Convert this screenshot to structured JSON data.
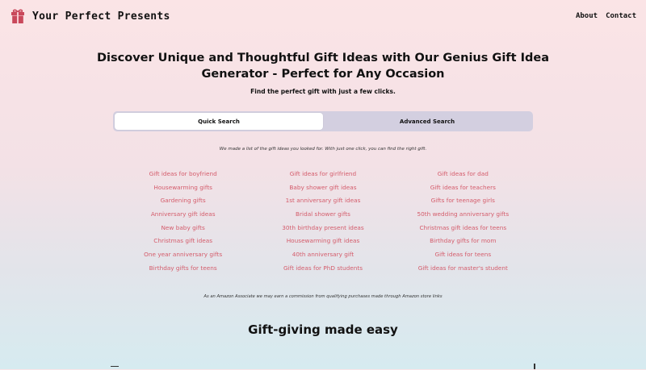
{
  "brand": {
    "name": "Your Perfect Presents",
    "icon": "gift-icon",
    "icon_color": "#c9485b"
  },
  "nav": {
    "about": "About",
    "contact": "Contact"
  },
  "hero": {
    "title": "Discover Unique and Thoughtful Gift Ideas with Our Genius Gift Idea Generator - Perfect for Any Occasion",
    "subtitle": "Find the perfect gift with just a few clicks."
  },
  "tabs": {
    "quick": "Quick Search",
    "advanced": "Advanced Search",
    "selected": "Quick Search"
  },
  "intro": "We made a list of the gift ideas you looked for. With just one click, you can find the right gift.",
  "gift_links": [
    "Gift ideas for boyfriend",
    "Gift ideas for girlfriend",
    "Gift ideas for dad",
    "Housewarming gifts",
    "Baby shower gift ideas",
    "Gift ideas for teachers",
    "Gardening gifts",
    "1st anniversary gift ideas",
    "Gifts for teenage girls",
    "Anniversary gift ideas",
    "Bridal shower gifts",
    "50th wedding anniversary gifts",
    "New baby gifts",
    "30th birthday present ideas",
    "Christmas gift ideas for teens",
    "Christmas gift ideas",
    "Housewarming gift ideas",
    "Birthday gifts for mom",
    "One year anniversary gifts",
    "40th anniversary gift",
    "Gift ideas for teens",
    "Birthday gifts for teens",
    "Gift ideas for PhD students",
    "Gift ideas for master's student"
  ],
  "disclaimer": "As an Amazon Associate we may earn a commission from qualifying purchases made through Amazon store links",
  "section": {
    "title": "Gift-giving made easy"
  },
  "colors": {
    "link": "#d45c6b",
    "tab_track": "#d3cfe0",
    "bg_top": "#fbe4e6",
    "bg_bottom": "#d6ebf0"
  }
}
